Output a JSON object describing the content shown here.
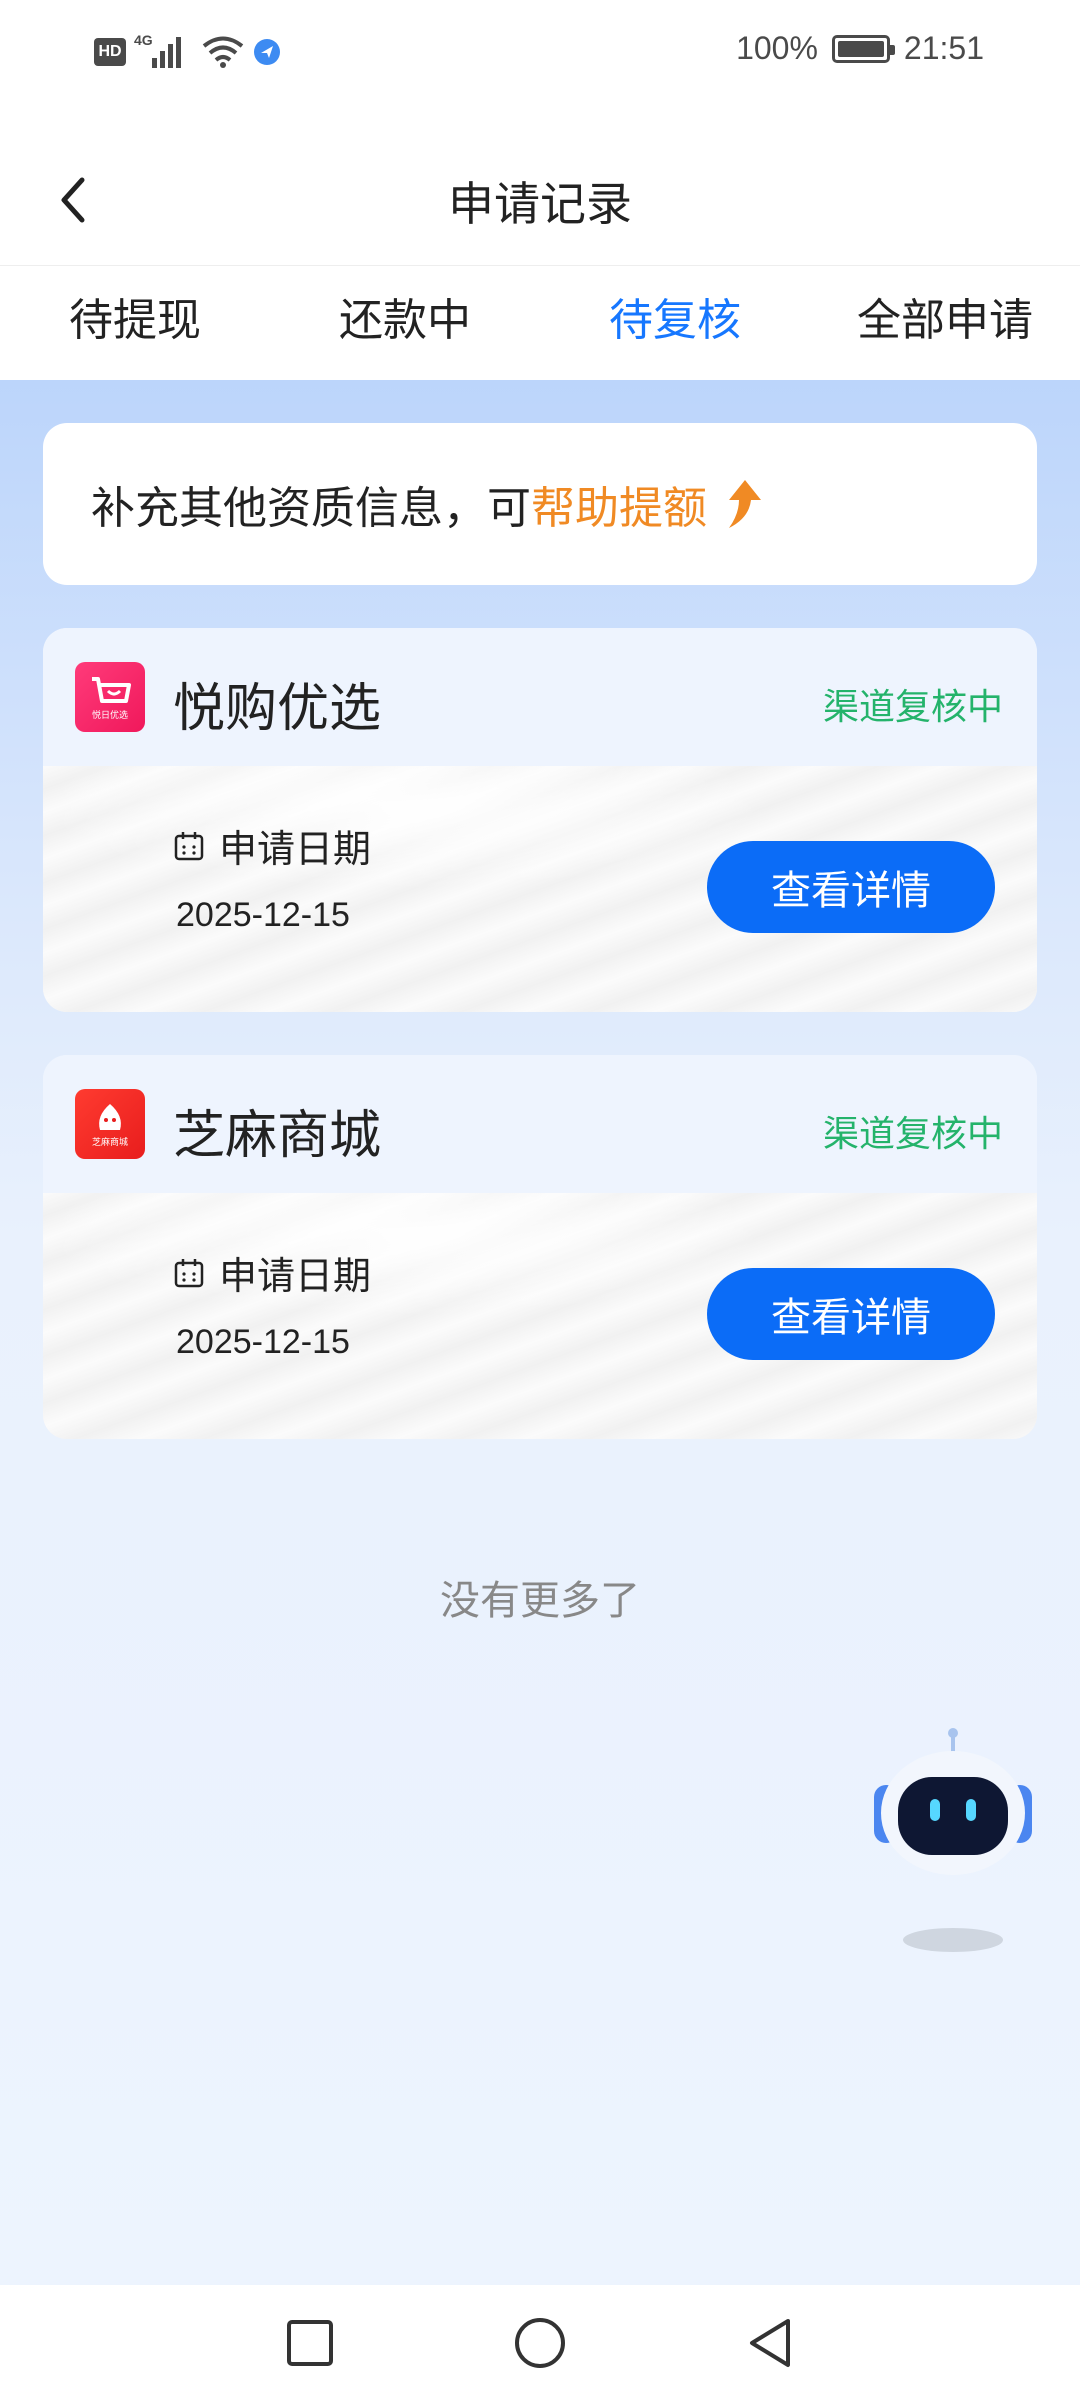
{
  "status_bar": {
    "hd": "HD",
    "network": "4G",
    "battery_percent": "100%",
    "time": "21:51"
  },
  "header": {
    "title": "申请记录"
  },
  "tabs": [
    {
      "label": "待提现",
      "active": false
    },
    {
      "label": "还款中",
      "active": false
    },
    {
      "label": "待复核",
      "active": true
    },
    {
      "label": "全部申请",
      "active": false
    }
  ],
  "promo": {
    "text": "补充其他资质信息，可",
    "highlight": "帮助提额"
  },
  "applications": [
    {
      "name": "悦购优选",
      "logo_text": "悦日优选",
      "status": "渠道复核中",
      "date_label": "申请日期",
      "date": "2025-12-15",
      "button": "查看详情"
    },
    {
      "name": "芝麻商城",
      "logo_text": "芝麻商城",
      "status": "渠道复核中",
      "date_label": "申请日期",
      "date": "2025-12-15",
      "button": "查看详情"
    }
  ],
  "footer_text": "没有更多了",
  "colors": {
    "accent": "#1677ff",
    "button": "#0b6cf7",
    "highlight": "#f08a24",
    "status": "#24b36b"
  },
  "icons": {
    "back": "chevron-left-icon",
    "promo": "arrow-up-icon",
    "calendar": "calendar-icon",
    "assistant": "robot-icon",
    "nav": [
      "square-icon",
      "circle-icon",
      "triangle-back-icon"
    ]
  }
}
